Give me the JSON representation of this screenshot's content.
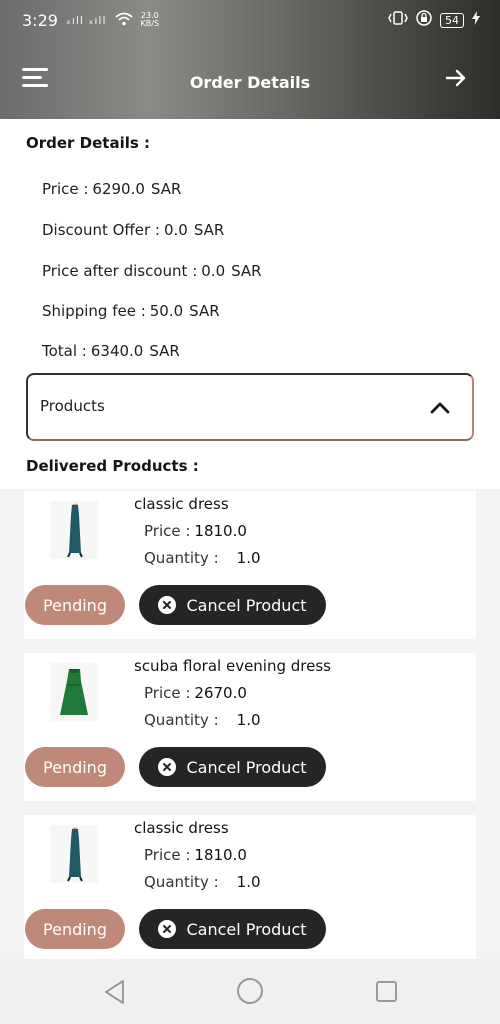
{
  "status_bar": {
    "time": "3:29",
    "signal": "ₓıll ₓıll",
    "net_speed_value": "23.0",
    "net_speed_unit": "KB/S",
    "battery": "54"
  },
  "header": {
    "title": "Order Details"
  },
  "order": {
    "section_title": "Order Details :",
    "price_label": "Price :",
    "price_value": "6290.0",
    "discount_label": "Discount Offer :",
    "discount_value": "0.0",
    "after_discount_label": "Price after discount :",
    "after_discount_value": "0.0",
    "shipping_label": "Shipping fee :",
    "shipping_value": "50.0",
    "total_label": "Total :",
    "total_value": "6340.0",
    "currency": "SAR"
  },
  "products_accordion": {
    "label": "Products"
  },
  "delivered": {
    "title": "Delivered Products :",
    "price_label": "Price :",
    "quantity_label": "Quantity :",
    "pending_label": "Pending",
    "cancel_label": "Cancel Product",
    "items": [
      {
        "name": "classic dress",
        "price": "1810.0",
        "quantity": "1.0",
        "dress_color": "#1f5a66"
      },
      {
        "name": "scuba floral evening dress",
        "price": "2670.0",
        "quantity": "1.0",
        "dress_color": "#1f7a3a"
      },
      {
        "name": "classic dress",
        "price": "1810.0",
        "quantity": "1.0",
        "dress_color": "#1f5a66"
      }
    ]
  },
  "colors": {
    "pending": "#c08878",
    "cancel": "#252624",
    "accent_border": "#b38676"
  }
}
